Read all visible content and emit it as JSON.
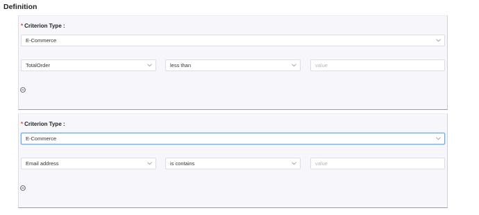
{
  "page": {
    "title": "Definition"
  },
  "criteria": [
    {
      "label": "Criterion Type :",
      "type_value": "E-Commerce",
      "field_value": "TotalOrder",
      "operator_value": "less than",
      "value_placeholder": "value",
      "focused": false
    },
    {
      "label": "Criterion Type :",
      "type_value": "E-Commerce",
      "field_value": "Email address",
      "operator_value": "is contains",
      "value_placeholder": "value",
      "focused": true
    }
  ],
  "icons": {
    "chevron": "chevron-down-icon",
    "remove": "minus-circle-icon",
    "required": "asterisk"
  },
  "colors": {
    "required": "#e03b3b",
    "focus_border": "#6aa8e8",
    "card_bg": "#f6f6fb"
  }
}
